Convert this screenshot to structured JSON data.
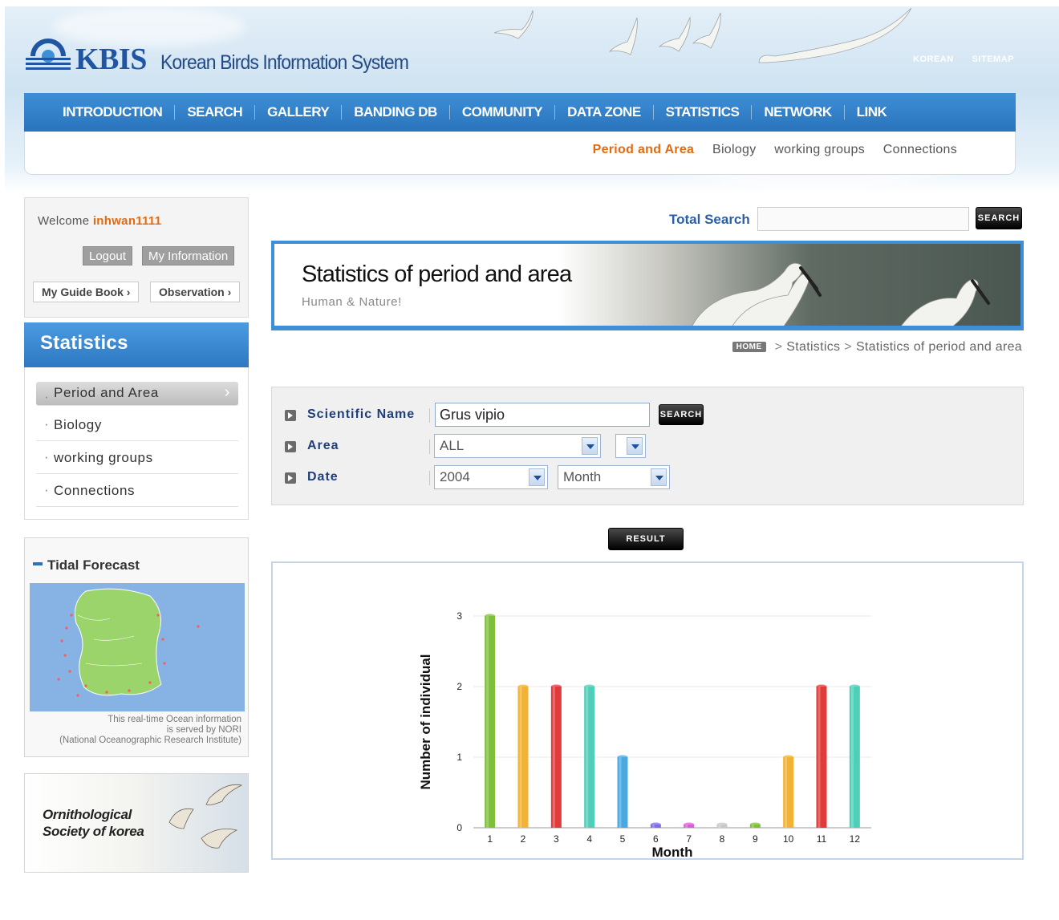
{
  "header": {
    "logo_text": "KBIS",
    "logo_sub": "Korean Birds Information System",
    "util_links": [
      "KOREAN",
      "SITEMAP"
    ]
  },
  "gnb": [
    "INTRODUCTION",
    "SEARCH",
    "GALLERY",
    "BANDING DB",
    "COMMUNITY",
    "DATA ZONE",
    "STATISTICS",
    "NETWORK",
    "LINK"
  ],
  "sub_nav": {
    "items": [
      "Period and Area",
      "Biology",
      "working groups",
      "Connections"
    ],
    "active_index": 0
  },
  "login": {
    "welcome": "Welcome",
    "username": "inhwan1111",
    "logout": "Logout",
    "my_info": "My Information",
    "guide_book": "My Guide Book",
    "observation": "Observation"
  },
  "sidebar": {
    "title": "Statistics",
    "items": [
      "Period and Area",
      "Biology",
      "working groups",
      "Connections"
    ]
  },
  "tidal": {
    "title": "Tidal Forecast",
    "note_lines": [
      "This real-time Ocean information",
      "is served by NORI",
      "(National Oceanographic Research Institute)"
    ]
  },
  "orni": {
    "line1": "Ornithological",
    "line2": "Society of korea"
  },
  "total_search": {
    "label": "Total Search",
    "value": "",
    "button": "SEARCH"
  },
  "banner": {
    "title": "Statistics of period and area",
    "subtitle": "Human & Nature!"
  },
  "breadcrumb": {
    "home": "HOME",
    "items": [
      "Statistics",
      "Statistics of period and area"
    ]
  },
  "search_form": {
    "sci_label": "Scientific Name",
    "sci_value": "Grus vipio",
    "sci_button": "SEARCH",
    "area_label": "Area",
    "area_value": "ALL",
    "area_sub_value": "",
    "date_label": "Date",
    "year_value": "2004",
    "period_value": "Month",
    "result_button": "RESULT"
  },
  "colors": {
    "brand_blue": "#2a73bd",
    "accent_orange": "#e26b10"
  },
  "chart_data": {
    "type": "bar",
    "title": "",
    "xlabel": "Month",
    "ylabel": "Number of individual",
    "ylim": [
      0,
      3
    ],
    "yticks": [
      "0",
      "1",
      "2",
      "3"
    ],
    "categories": [
      "1",
      "2",
      "3",
      "4",
      "5",
      "6",
      "7",
      "8",
      "9",
      "10",
      "11",
      "12"
    ],
    "values": [
      3,
      2,
      2,
      2,
      1,
      0,
      0,
      0,
      0,
      1,
      2,
      2
    ],
    "bar_colors": [
      "#7ec03a",
      "#f2b233",
      "#e03a3a",
      "#4fcfb8",
      "#4aa8e0",
      "#7b6ee8",
      "#d85ed8",
      "#c8c8c8",
      "#7ec03a",
      "#f2b233",
      "#e03a3a",
      "#4fcfb8"
    ]
  }
}
